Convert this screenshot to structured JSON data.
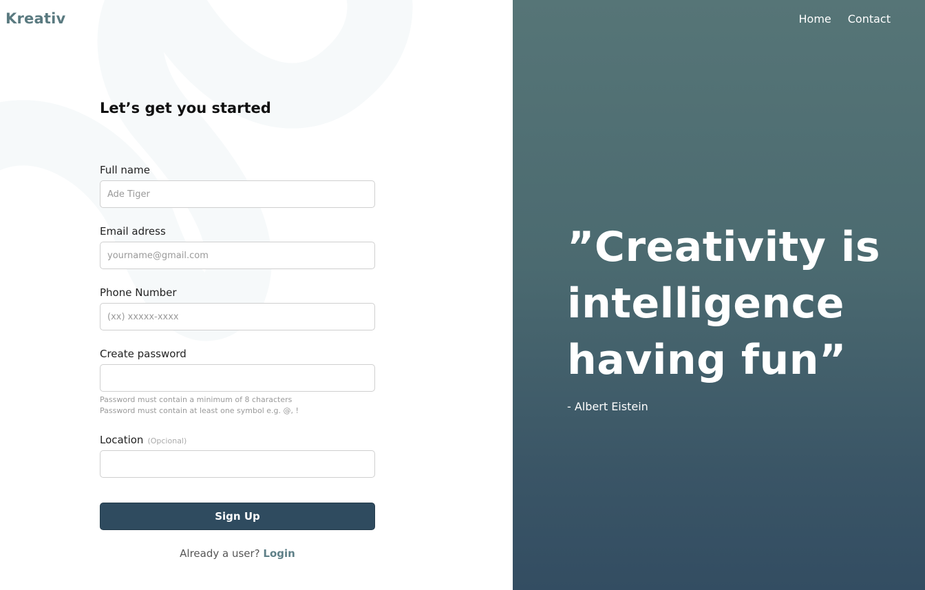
{
  "brand": {
    "name": "Kreativ"
  },
  "form": {
    "title": "Let’s get you started",
    "full_name": {
      "label": "Full name",
      "placeholder": "Ade Tiger",
      "value": ""
    },
    "email": {
      "label": "Email adress",
      "placeholder": "yourname@gmail.com",
      "value": ""
    },
    "phone": {
      "label": "Phone Number",
      "placeholder": "(xx) xxxxx-xxxx",
      "value": ""
    },
    "password": {
      "label": "Create password",
      "value": "",
      "hint_1": "Password must contain a minimum of 8 characters",
      "hint_2": "Password must contain at least one symbol e.g. @, !"
    },
    "location": {
      "label": "Location",
      "optional_label": "(Opcional)",
      "value": ""
    },
    "signup_label": "Sign Up",
    "login_prompt": "Already a user?",
    "login_label": "Login"
  },
  "nav": {
    "home": "Home",
    "contact": "Contact"
  },
  "quote": {
    "text": "”Creativity is intelligence having fun”",
    "author": "- Albert Eistein"
  },
  "colors": {
    "brand": "#5a7a80",
    "button": "#2f4b5f",
    "panel_top": "#567577",
    "panel_bottom": "#334d62",
    "link": "#5f8088"
  }
}
